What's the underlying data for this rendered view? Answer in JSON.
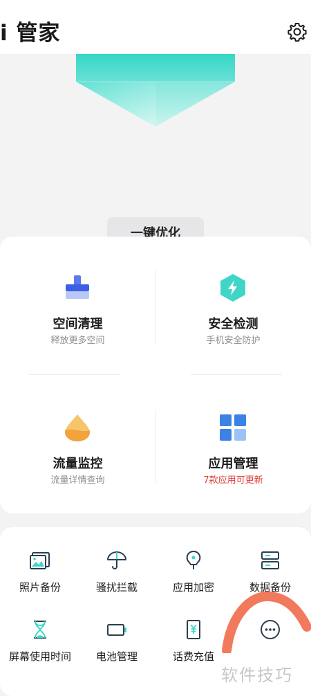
{
  "header": {
    "title": "i 管家"
  },
  "hero": {
    "optimize_label": "一键优化"
  },
  "features": [
    {
      "title": "空间清理",
      "subtitle": "释放更多空间",
      "icon": "broom-icon"
    },
    {
      "title": "安全检测",
      "subtitle": "手机安全防护",
      "icon": "shield-bolt-icon"
    },
    {
      "title": "流量监控",
      "subtitle": "流量详情查询",
      "icon": "water-drop-icon"
    },
    {
      "title": "应用管理",
      "subtitle": "7款应用可更新",
      "icon": "app-grid-icon"
    }
  ],
  "tools": [
    {
      "label": "照片备份",
      "icon": "photo-icon"
    },
    {
      "label": "骚扰拦截",
      "icon": "umbrella-icon"
    },
    {
      "label": "应用加密",
      "icon": "lock-bulb-icon"
    },
    {
      "label": "数据备份",
      "icon": "storage-icon"
    },
    {
      "label": "屏幕使用时间",
      "icon": "hourglass-icon"
    },
    {
      "label": "电池管理",
      "icon": "battery-icon"
    },
    {
      "label": "话费充值",
      "icon": "yuan-card-icon"
    }
  ],
  "watermark": "软件技巧",
  "colors": {
    "accent_teal": "#3fd6c8",
    "accent_blue": "#3b82e6",
    "alert_red": "#e0403a"
  }
}
